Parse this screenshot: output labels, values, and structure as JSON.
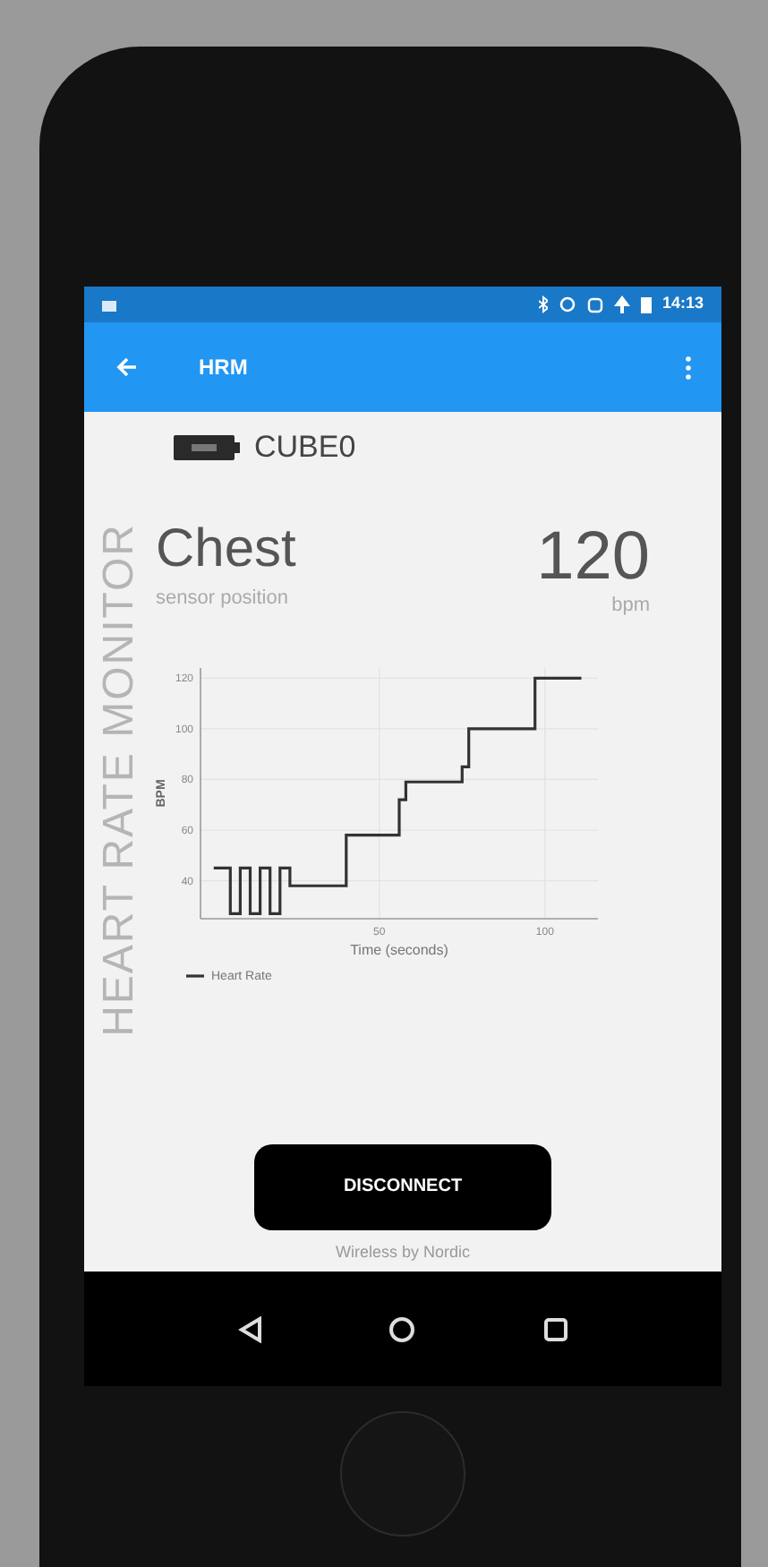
{
  "status_bar": {
    "time": "14:13"
  },
  "app_bar": {
    "title": "HRM"
  },
  "device": {
    "name": "CUBE0"
  },
  "side_label": "HEART RATE MONITOR",
  "sensor": {
    "position": "Chest",
    "position_caption": "sensor position"
  },
  "heart_rate": {
    "value": "120",
    "unit": "bpm"
  },
  "chart_data": {
    "type": "line",
    "xlabel": "Time (seconds)",
    "ylabel": "BPM",
    "xlim": [
      -4,
      116
    ],
    "ylim": [
      25,
      124
    ],
    "xticks": [
      50,
      100
    ],
    "yticks": [
      40,
      60,
      80,
      100,
      120
    ],
    "grid": true,
    "x": [
      0,
      5,
      5,
      8,
      8,
      11,
      11,
      14,
      14,
      17,
      17,
      20,
      20,
      23,
      23,
      40,
      40,
      56,
      56,
      58,
      58,
      75,
      75,
      77,
      77,
      97,
      97,
      111
    ],
    "series": [
      {
        "name": "Heart Rate",
        "color": "#333333",
        "values": [
          45,
          45,
          27,
          27,
          45,
          45,
          27,
          27,
          45,
          45,
          27,
          27,
          45,
          45,
          38,
          38,
          58,
          58,
          72,
          72,
          79,
          79,
          85,
          85,
          100,
          100,
          120,
          120
        ]
      }
    ]
  },
  "button": {
    "label": "DISCONNECT"
  },
  "footer": "Wireless by Nordic"
}
